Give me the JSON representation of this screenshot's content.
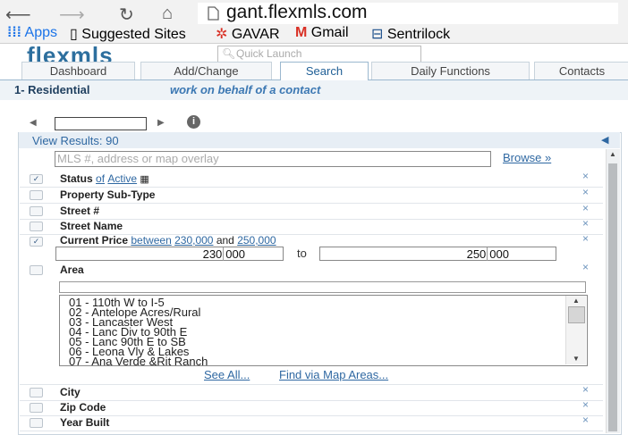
{
  "browser": {
    "back_icon": "back-arrow-icon",
    "forward_icon": "forward-arrow-icon",
    "reload_icon": "reload-icon",
    "home_icon": "home-icon",
    "url": "gant.flexmls.com",
    "bookmarks": [
      {
        "label": "Apps",
        "icon": "apps-grid-icon",
        "color": "#1a73e8"
      },
      {
        "label": "Suggested Sites",
        "icon": "page-icon"
      },
      {
        "label": "GAVAR",
        "icon": "gavar-icon",
        "color": "#d93025"
      },
      {
        "label": "Gmail",
        "icon": "gmail-icon",
        "color": "#d93025"
      },
      {
        "label": "Sentrilock",
        "icon": "sentrilock-icon",
        "color": "#1a4e8a"
      }
    ]
  },
  "app": {
    "logo": "flexmls",
    "quick_launch_placeholder": "Quick Launch",
    "tabs": [
      "Dashboard",
      "Add/Change",
      "Search",
      "Daily Functions",
      "Contacts"
    ],
    "active_tab": "Search",
    "property_type": "1- Residential",
    "mode": "work on behalf of a contact"
  },
  "search": {
    "view_results": "View Results: 90",
    "mls_placeholder": "MLS #, address or map overlay",
    "browse": "Browse »",
    "fields": [
      {
        "label": "Status",
        "checked": true,
        "of": "of",
        "value": "Active"
      },
      {
        "label": "Property Sub-Type",
        "checked": false
      },
      {
        "label": "Street #",
        "checked": false
      },
      {
        "label": "Street Name",
        "checked": false
      },
      {
        "label": "Current Price",
        "checked": true,
        "between": "between",
        "low": "230,000",
        "and": "and",
        "high": "250,000"
      }
    ],
    "price_low": "230",
    "price_low_sep": "000",
    "price_to": "to",
    "price_high": "250",
    "price_high_sep": "000",
    "area_label": "Area",
    "area_options": [
      "01 - 110th W to I-5",
      "02 - Antelope Acres/Rural",
      "03 - Lancaster West",
      "04 - Lanc Div to 90th E",
      "05 - Lanc 90th E to SB",
      "06 - Leona Vly & Lakes",
      "07 - Ana Verde &Rit Ranch"
    ],
    "see_all": "See All...",
    "find_via": "Find via Map Areas...",
    "more_fields": [
      "City",
      "Zip Code",
      "Year Built"
    ],
    "remove": "×"
  }
}
